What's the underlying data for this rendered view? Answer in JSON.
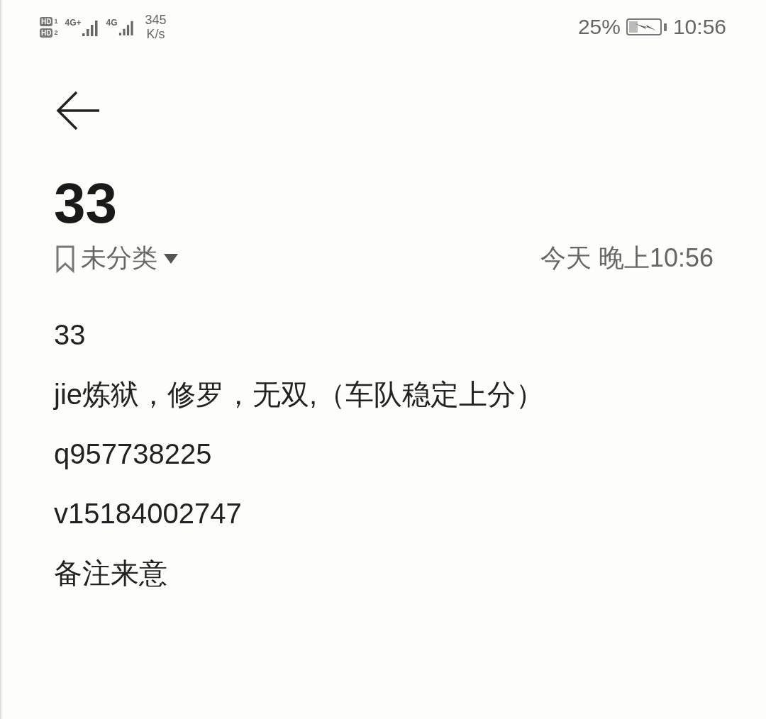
{
  "status_bar": {
    "sims": [
      {
        "badge": "HD",
        "number": "1",
        "network": "4G+"
      },
      {
        "badge": "HD",
        "number": "2",
        "network": "4G"
      }
    ],
    "speed": "345",
    "speed_unit": "K/s",
    "battery_percent": "25%",
    "time": "10:56"
  },
  "note": {
    "title": "33",
    "category": "未分类",
    "timestamp": "今天 晚上10:56",
    "lines": [
      "33",
      "jie炼狱，修罗，无双,（车队稳定上分）",
      "q957738225",
      "v15184002747",
      "备注来意"
    ]
  }
}
